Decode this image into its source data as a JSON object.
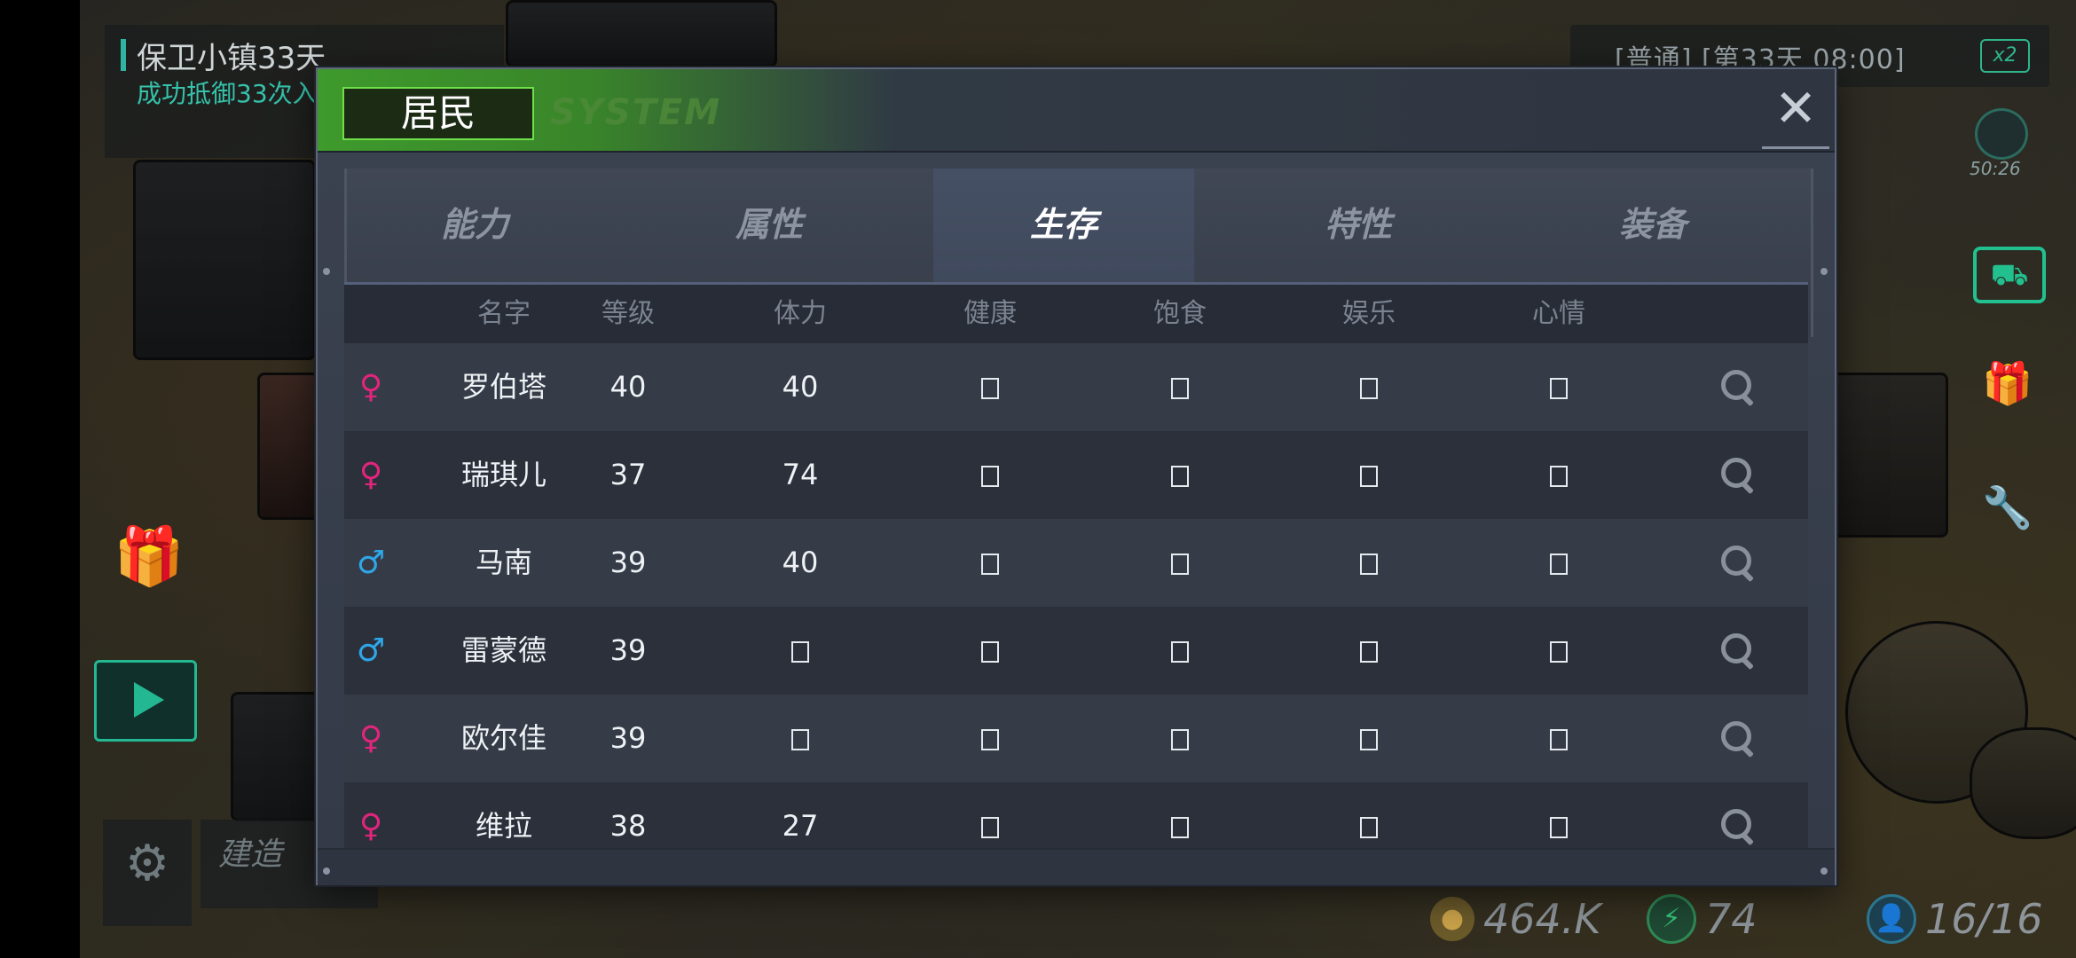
{
  "hud": {
    "mission_title": "保卫小镇33天",
    "mission_sub": "成功抵御33次入",
    "time": "[普通] [第33天 08:00]",
    "speed": "x2",
    "timer": "50:26",
    "build_label": "建造"
  },
  "resources": {
    "coins": "464.K",
    "energy": "74",
    "population": "16/16"
  },
  "dialog": {
    "title": "居民",
    "subtitle": "SYSTEM",
    "close_label": "✕",
    "tabs": [
      {
        "label": "能力",
        "active": false
      },
      {
        "label": "属性",
        "active": false
      },
      {
        "label": "生存",
        "active": true
      },
      {
        "label": "特性",
        "active": false
      },
      {
        "label": "装备",
        "active": false
      }
    ],
    "columns": [
      "名字",
      "等级",
      "体力",
      "健康",
      "饱食",
      "娱乐",
      "心情"
    ],
    "rows": [
      {
        "gender": "♀",
        "gender_type": "f",
        "name": "罗伯塔",
        "level": "40",
        "stamina": "40"
      },
      {
        "gender": "♀",
        "gender_type": "f",
        "name": "瑞琪儿",
        "level": "37",
        "stamina": "74"
      },
      {
        "gender": "♂",
        "gender_type": "m",
        "name": "马南",
        "level": "39",
        "stamina": "40"
      },
      {
        "gender": "♂",
        "gender_type": "m",
        "name": "雷蒙德",
        "level": "39",
        "stamina": ""
      },
      {
        "gender": "♀",
        "gender_type": "f",
        "name": "欧尔佳",
        "level": "39",
        "stamina": ""
      },
      {
        "gender": "♀",
        "gender_type": "f",
        "name": "维拉",
        "level": "38",
        "stamina": "27"
      }
    ]
  },
  "colors": {
    "accent_green": "#3e9a2c",
    "female": "#e0257d",
    "male": "#2fa6e8",
    "hud_teal": "#23c08f"
  },
  "icons": [
    "gift-icon",
    "video-icon",
    "gear-icon",
    "jeep-icon",
    "wrench-icon",
    "timer-icon",
    "coin-icon",
    "energy-icon",
    "population-icon",
    "search-icon",
    "close-icon"
  ]
}
